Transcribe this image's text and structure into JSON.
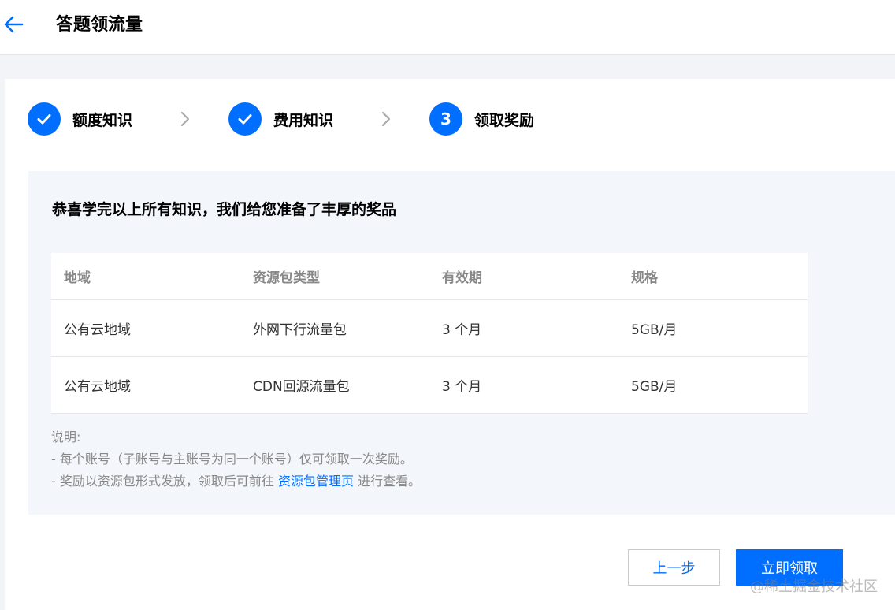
{
  "header": {
    "title": "答题领流量"
  },
  "steps": [
    {
      "label": "额度知识",
      "status": "done",
      "icon": "check-icon"
    },
    {
      "label": "费用知识",
      "status": "done",
      "icon": "check-icon"
    },
    {
      "label": "领取奖励",
      "status": "current",
      "number": "3"
    }
  ],
  "panel": {
    "heading": "恭喜学完以上所有知识，我们给您准备了丰厚的奖品",
    "table": {
      "columns": [
        "地域",
        "资源包类型",
        "有效期",
        "规格"
      ],
      "rows": [
        [
          "公有云地域",
          "外网下行流量包",
          "3 个月",
          "5GB/月"
        ],
        [
          "公有云地域",
          "CDN回源流量包",
          "3 个月",
          "5GB/月"
        ]
      ]
    },
    "notes": {
      "title": "说明:",
      "line1": "- 每个账号（子账号与主账号为同一个账号）仅可领取一次奖励。",
      "line2_prefix": "- 奖励以资源包形式发放，领取后可前往 ",
      "line2_link": "资源包管理页",
      "line2_suffix": " 进行查看。"
    }
  },
  "actions": {
    "prev_label": "上一步",
    "claim_label": "立即领取"
  },
  "watermark": "@稀土掘金技术社区",
  "colors": {
    "accent": "#006eff",
    "panel_bg": "#f3f6fa",
    "page_bg": "#f3f4f7"
  }
}
